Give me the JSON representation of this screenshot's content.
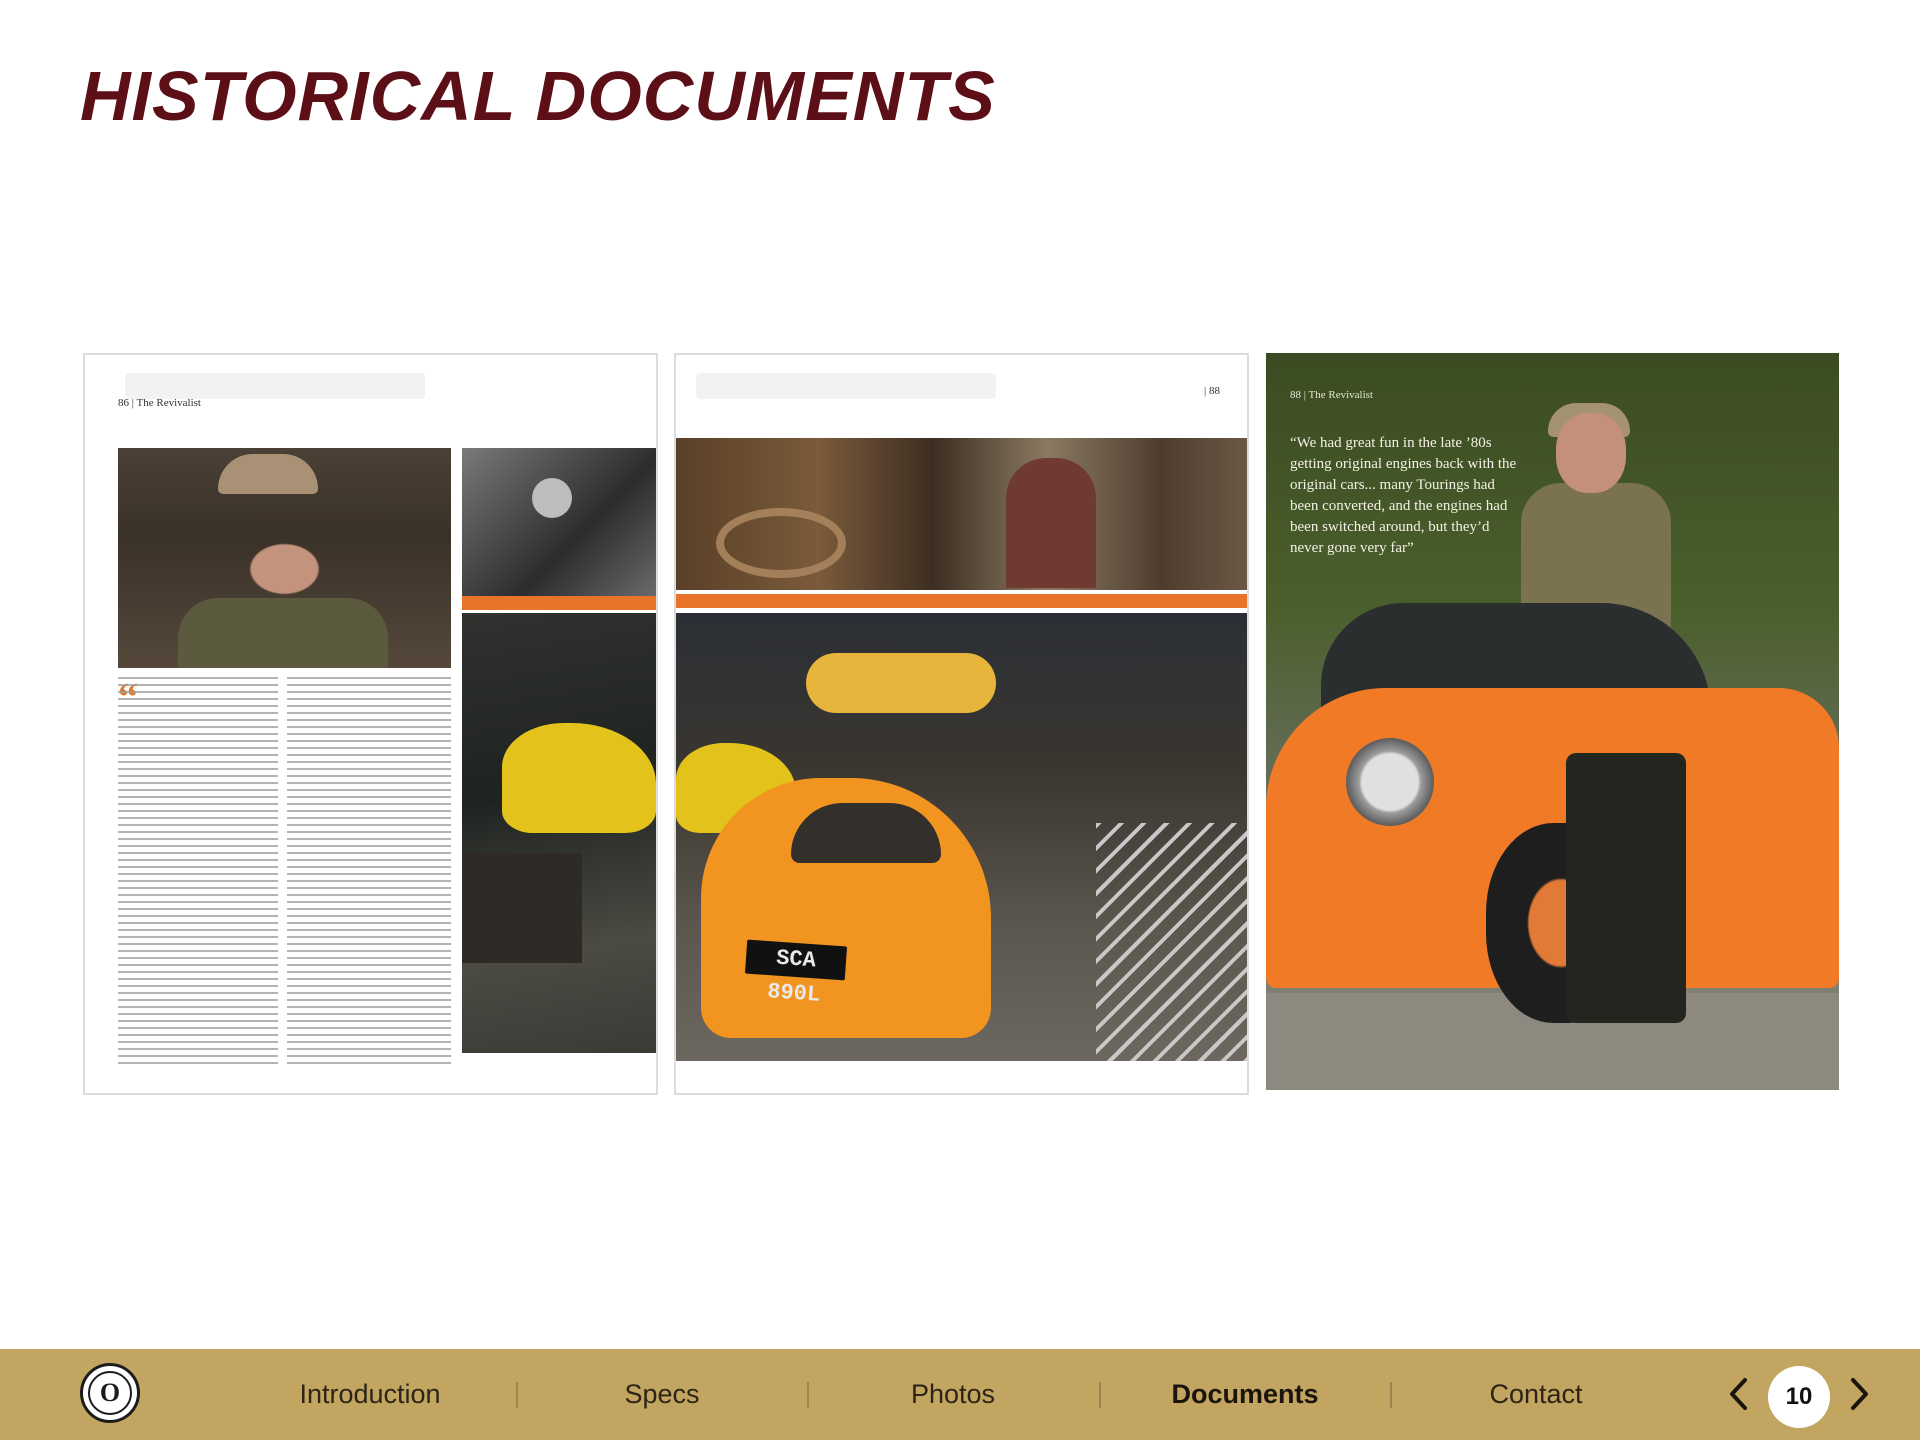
{
  "page": {
    "title": "HISTORICAL DOCUMENTS"
  },
  "magazine": {
    "page1_folio": "86 | The Revivalist",
    "page2_folio": "| 88",
    "page3_folio": "88 | The Revivalist",
    "pull_quote": "“We had great fun in the late ’80s getting original engines back with the original cars... many Tourings had been converted, and the engines had been switched around, but they’d never gone very far”",
    "license_plate": "SCA 890L"
  },
  "nav": {
    "items": [
      {
        "label": "Introduction"
      },
      {
        "label": "Specs"
      },
      {
        "label": "Photos"
      },
      {
        "label": "Documents"
      },
      {
        "label": "Contact"
      }
    ],
    "active_item": "Documents",
    "page_number": "10",
    "logo_glyph": "O",
    "prev_icon": "chevron-left-icon",
    "next_icon": "chevron-right-icon"
  },
  "colors": {
    "title": "#5c0f16",
    "nav_bar": "#c2a560",
    "accent_orange": "#f07a26"
  }
}
